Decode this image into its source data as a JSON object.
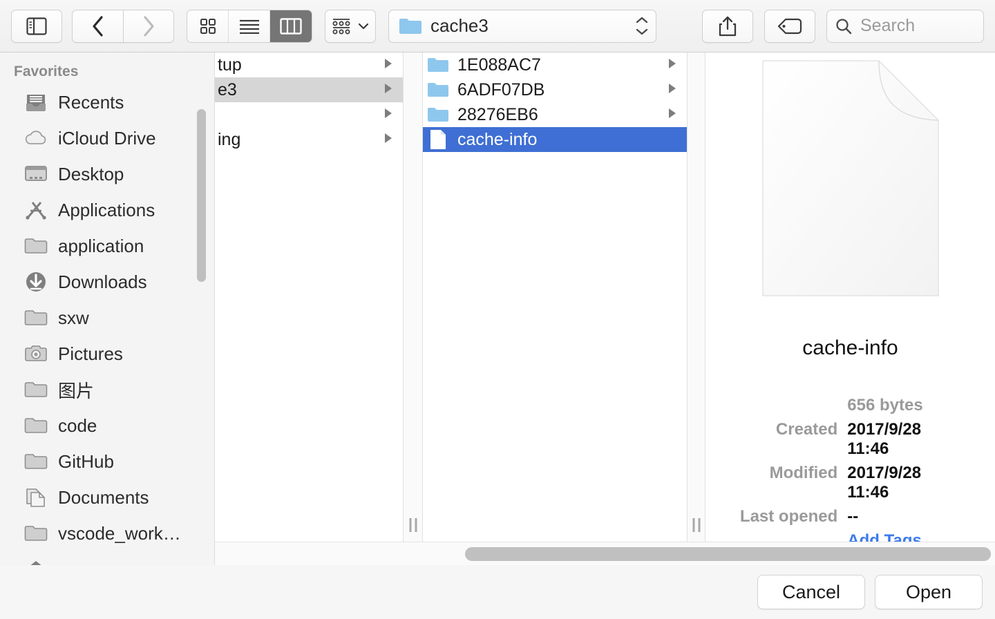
{
  "toolbar": {
    "sidebar_toggle": "sidebar-toggle",
    "back": "back",
    "forward": "forward",
    "view_icon": "icon-view",
    "view_list": "list-view",
    "view_column": "column-view",
    "arrange": "arrange",
    "path_label": "cache3",
    "share": "share",
    "tags": "tags",
    "search_placeholder": "Search"
  },
  "sidebar": {
    "header": "Favorites",
    "items": [
      {
        "label": "Recents",
        "icon": "recents-icon"
      },
      {
        "label": "iCloud Drive",
        "icon": "icloud-icon"
      },
      {
        "label": "Desktop",
        "icon": "desktop-icon"
      },
      {
        "label": "Applications",
        "icon": "applications-icon"
      },
      {
        "label": "application",
        "icon": "folder-icon"
      },
      {
        "label": "Downloads",
        "icon": "downloads-icon"
      },
      {
        "label": "sxw",
        "icon": "folder-icon"
      },
      {
        "label": "Pictures",
        "icon": "pictures-icon"
      },
      {
        "label": "图片",
        "icon": "folder-icon"
      },
      {
        "label": "code",
        "icon": "folder-icon"
      },
      {
        "label": "GitHub",
        "icon": "folder-icon"
      },
      {
        "label": "Documents",
        "icon": "documents-icon"
      },
      {
        "label": "vscode_work…",
        "icon": "folder-icon"
      },
      {
        "label": ".",
        "icon": "home-icon"
      }
    ]
  },
  "column1": {
    "items": [
      {
        "label": "tup",
        "selected": false,
        "has_children": true
      },
      {
        "label": "e3",
        "selected": true,
        "has_children": true
      },
      {
        "label": "",
        "selected": false,
        "has_children": true
      },
      {
        "label": "ing",
        "selected": false,
        "has_children": true
      }
    ]
  },
  "column2": {
    "items": [
      {
        "label": "1E088AC7",
        "type": "folder",
        "selected": false,
        "has_children": true
      },
      {
        "label": "6ADF07DB",
        "type": "folder",
        "selected": false,
        "has_children": true
      },
      {
        "label": "28276EB6",
        "type": "folder",
        "selected": false,
        "has_children": true
      },
      {
        "label": "cache-info",
        "type": "file",
        "selected": true,
        "has_children": false
      }
    ]
  },
  "preview": {
    "icon": "blank-document-icon",
    "title": "cache-info",
    "size": "656 bytes",
    "created_label": "Created",
    "created_value": "2017/9/28 11:46",
    "modified_label": "Modified",
    "modified_value": "2017/9/28 11:46",
    "last_opened_label": "Last opened",
    "last_opened_value": "--",
    "add_tags": "Add Tags…"
  },
  "footer": {
    "cancel": "Cancel",
    "open": "Open"
  },
  "colors": {
    "selection_active": "#3f6fd4",
    "selection_inactive": "#d6d6d6",
    "link": "#3c7bea",
    "folder": "#8ec7ee"
  }
}
